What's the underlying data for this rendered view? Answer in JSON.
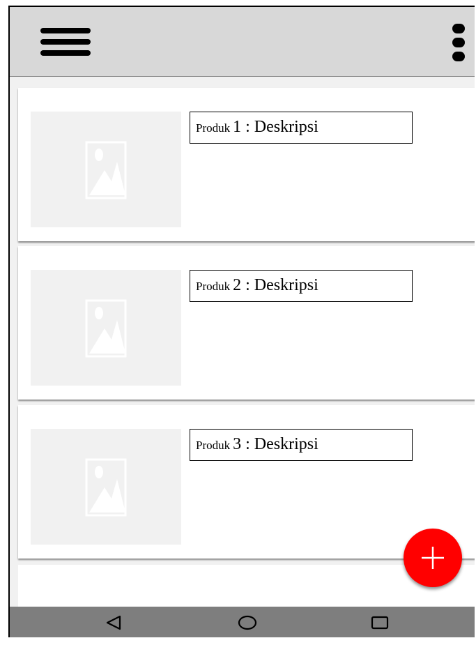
{
  "appbar": {
    "menu_icon": "hamburger-menu-icon",
    "more_icon": "more-vertical-icon"
  },
  "products": [
    {
      "prefix": "Produk",
      "number": "1",
      "suffix": " : Deskripsi",
      "image_icon": "image-placeholder-icon"
    },
    {
      "prefix": "Produk",
      "number": "2",
      "suffix": " : Deskripsi",
      "image_icon": "image-placeholder-icon"
    },
    {
      "prefix": "Produk",
      "number": "3",
      "suffix": " : Deskripsi",
      "image_icon": "image-placeholder-icon"
    }
  ],
  "fab": {
    "icon": "plus-icon",
    "color": "#ff0000"
  },
  "navbar": {
    "back_icon": "back-triangle-icon",
    "home_icon": "home-circle-icon",
    "recent_icon": "recent-apps-square-icon"
  },
  "colors": {
    "appbar": "#d8d8d8",
    "navbar": "#7e7e7e",
    "fab": "#ff0000",
    "placeholder": "#f1f1f1"
  }
}
